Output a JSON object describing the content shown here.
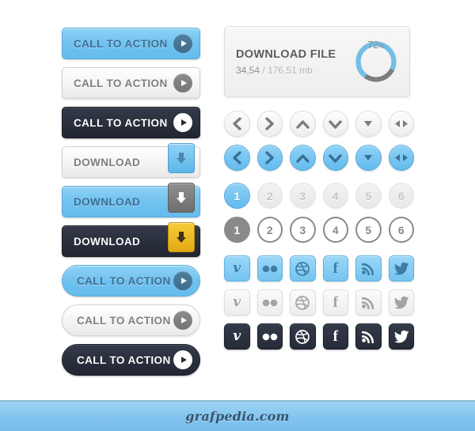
{
  "left_buttons": [
    {
      "label": "CALL TO ACTION",
      "style": "blue",
      "kind": "cta",
      "icon": "play-icon"
    },
    {
      "label": "CALL TO ACTION",
      "style": "gray",
      "kind": "cta",
      "icon": "play-icon"
    },
    {
      "label": "CALL TO ACTION",
      "style": "dark",
      "kind": "cta",
      "icon": "play-icon"
    },
    {
      "label": "DOWNLOAD",
      "style": "gray",
      "kind": "download",
      "icon": "download-arrow-icon",
      "tab": "blue"
    },
    {
      "label": "DOWNLOAD",
      "style": "blue",
      "kind": "download",
      "icon": "download-arrow-icon",
      "tab": "gray"
    },
    {
      "label": "DOWNLOAD",
      "style": "dark",
      "kind": "download",
      "icon": "download-arrow-icon",
      "tab": "gold"
    },
    {
      "label": "CALL TO ACTION",
      "style": "blue",
      "kind": "cta-pill",
      "icon": "play-icon"
    },
    {
      "label": "CALL TO ACTION",
      "style": "gray",
      "kind": "cta-pill",
      "icon": "play-icon"
    },
    {
      "label": "CALL TO ACTION",
      "style": "dark",
      "kind": "cta-pill",
      "icon": "play-icon"
    }
  ],
  "download_panel": {
    "title": "DOWNLOAD FILE",
    "downloaded": "34,54",
    "separator": "/",
    "total": "176,51 mb",
    "percent_label": "72",
    "percent_symbol": "%",
    "percent_value": 72,
    "ring_progress_color": "#72bfe8",
    "ring_track_color": "#7d7d7d"
  },
  "arrow_rows": [
    {
      "style": "gray",
      "items": [
        {
          "icon": "chevron-left-icon",
          "name": "arrow-left"
        },
        {
          "icon": "chevron-right-icon",
          "name": "arrow-right"
        },
        {
          "icon": "chevron-up-icon",
          "name": "arrow-up"
        },
        {
          "icon": "chevron-down-icon",
          "name": "arrow-down"
        },
        {
          "icon": "triangle-down-icon",
          "name": "arrow-small-down"
        },
        {
          "icon": "left-right-arrow-icon",
          "name": "arrow-left-right"
        }
      ]
    },
    {
      "style": "blue",
      "items": [
        {
          "icon": "chevron-left-icon",
          "name": "arrow-left"
        },
        {
          "icon": "chevron-right-icon",
          "name": "arrow-right"
        },
        {
          "icon": "chevron-up-icon",
          "name": "arrow-up"
        },
        {
          "icon": "chevron-down-icon",
          "name": "arrow-down"
        },
        {
          "icon": "triangle-down-icon",
          "name": "arrow-small-down"
        },
        {
          "icon": "left-right-arrow-icon",
          "name": "arrow-left-right"
        }
      ]
    }
  ],
  "pagination_rows": [
    {
      "style": "filled",
      "active_index": 0,
      "pages": [
        "1",
        "2",
        "3",
        "4",
        "5",
        "6"
      ]
    },
    {
      "style": "outlined",
      "active_index": 0,
      "pages": [
        "1",
        "2",
        "3",
        "4",
        "5",
        "6"
      ]
    }
  ],
  "social_rows": [
    {
      "style": "blue",
      "items": [
        {
          "icon": "vimeo-icon",
          "label": "Vimeo"
        },
        {
          "icon": "flickr-icon",
          "label": "Flickr"
        },
        {
          "icon": "dribbble-icon",
          "label": "Dribbble"
        },
        {
          "icon": "facebook-icon",
          "label": "Facebook"
        },
        {
          "icon": "rss-icon",
          "label": "RSS"
        },
        {
          "icon": "twitter-icon",
          "label": "Twitter"
        }
      ]
    },
    {
      "style": "gray",
      "items": [
        {
          "icon": "vimeo-icon",
          "label": "Vimeo"
        },
        {
          "icon": "flickr-icon",
          "label": "Flickr"
        },
        {
          "icon": "dribbble-icon",
          "label": "Dribbble"
        },
        {
          "icon": "facebook-icon",
          "label": "Facebook"
        },
        {
          "icon": "rss-icon",
          "label": "RSS"
        },
        {
          "icon": "twitter-icon",
          "label": "Twitter"
        }
      ]
    },
    {
      "style": "dark",
      "items": [
        {
          "icon": "vimeo-icon",
          "label": "Vimeo"
        },
        {
          "icon": "flickr-icon",
          "label": "Flickr"
        },
        {
          "icon": "dribbble-icon",
          "label": "Dribbble"
        },
        {
          "icon": "facebook-icon",
          "label": "Facebook"
        },
        {
          "icon": "rss-icon",
          "label": "RSS"
        },
        {
          "icon": "twitter-icon",
          "label": "Twitter"
        }
      ]
    }
  ],
  "footer": {
    "watermark": "grafpedia.com"
  },
  "colors": {
    "blue": "#72c2ef",
    "dark": "#2b303e",
    "gray": "#f1f1f1",
    "gold": "#e8b01a",
    "text_blue": "#3c6f93",
    "text_gray": "#7e7e7e"
  }
}
